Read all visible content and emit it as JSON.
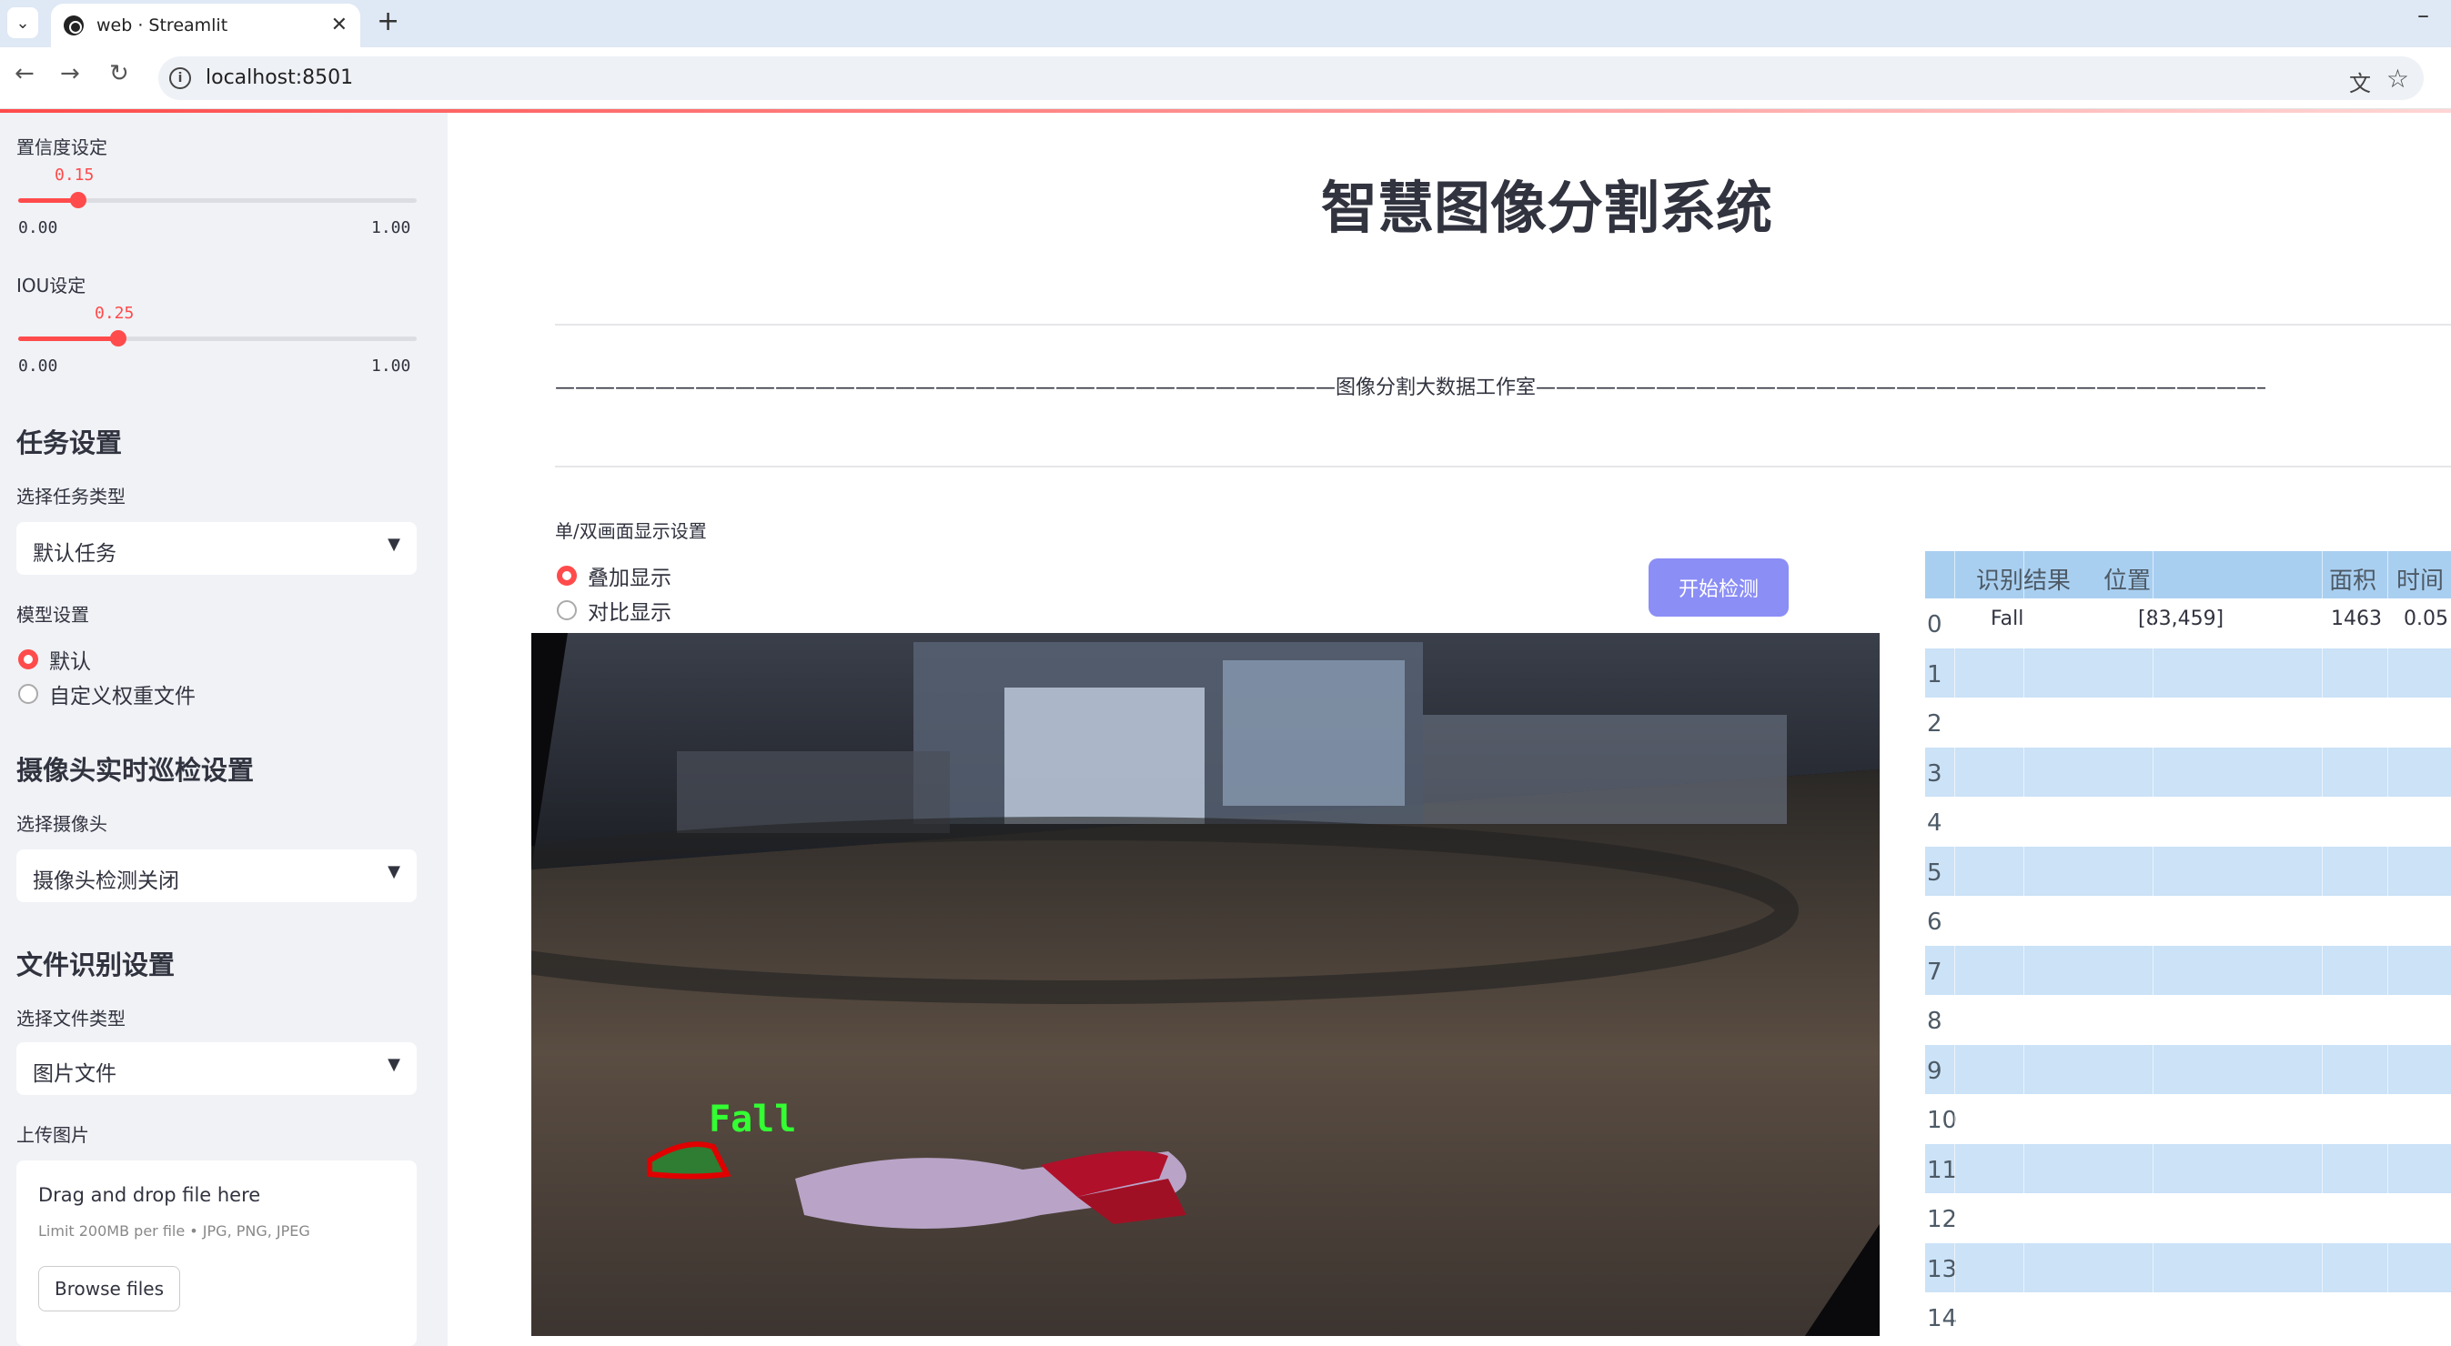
{
  "browser": {
    "tab_title": "web · Streamlit",
    "url": "localhost:8501"
  },
  "sidebar": {
    "confidence": {
      "label": "置信度设定",
      "value": "0.15",
      "min": "0.00",
      "max": "1.00",
      "fraction": 0.15
    },
    "iou": {
      "label": "IOU设定",
      "value": "0.25",
      "min": "0.00",
      "max": "1.00",
      "fraction": 0.25
    },
    "task_section": {
      "title": "任务设置",
      "label": "选择任务类型",
      "selected": "默认任务"
    },
    "model_section": {
      "label": "模型设置",
      "options": [
        "默认",
        "自定义权重文件"
      ],
      "selected_index": 0
    },
    "camera_section": {
      "title": "摄像头实时巡检设置",
      "label": "选择摄像头",
      "selected": "摄像头检测关闭"
    },
    "file_section": {
      "title": "文件识别设置",
      "label": "选择文件类型",
      "selected": "图片文件"
    },
    "upload": {
      "label": "上传图片",
      "dropzone_title": "Drag and drop file here",
      "dropzone_hint": "Limit 200MB per file • JPG, PNG, JPEG",
      "browse_label": "Browse files"
    }
  },
  "main": {
    "title": "智慧图像分割系统",
    "banner": "———————————————————————————————————————图像分割大数据工作室———————————————————————————————————————",
    "display_mode": {
      "label": "单/双画面显示设置",
      "options": [
        "叠加显示",
        "对比显示"
      ],
      "selected_index": 0
    },
    "start_button": "开始检测",
    "detection_label": "Fall"
  },
  "results_table": {
    "headers": [
      "识别结果",
      "位置",
      "面积",
      "时间"
    ],
    "rows": [
      {
        "index": "0",
        "result": "Fall",
        "position": "[83,459]",
        "area": "1463",
        "time": "0.05"
      },
      {
        "index": "1"
      },
      {
        "index": "2"
      },
      {
        "index": "3"
      },
      {
        "index": "4"
      },
      {
        "index": "5"
      },
      {
        "index": "6"
      },
      {
        "index": "7"
      },
      {
        "index": "8"
      },
      {
        "index": "9"
      },
      {
        "index": "10"
      },
      {
        "index": "11"
      },
      {
        "index": "12"
      },
      {
        "index": "13"
      },
      {
        "index": "14"
      }
    ]
  },
  "colors": {
    "accent": "#ff4b4b",
    "button": "#8b8ef5",
    "table_stripe": "#cbe2f7",
    "table_header": "#a9cff0",
    "sidebar_bg": "#f0f2f6"
  }
}
